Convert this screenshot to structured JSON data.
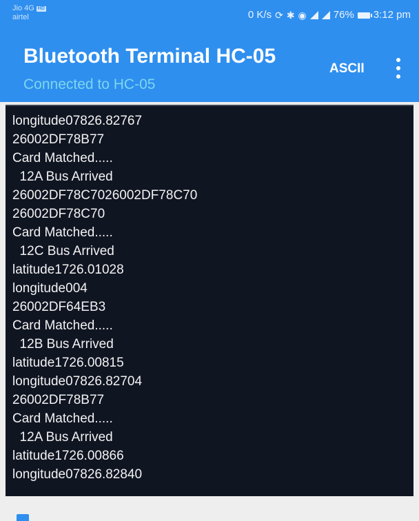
{
  "status_bar": {
    "carrier_top": "Jio 4G",
    "hd_badge": "HD",
    "carrier_bottom": "airtel",
    "net_speed": "0 K/s",
    "battery_percent": "76%",
    "time": "3:12 pm"
  },
  "app_bar": {
    "title": "Bluetooth Terminal HC-05",
    "subtitle": "Connected to HC-05",
    "ascii_label": "ASCII"
  },
  "terminal": {
    "lines": [
      "longitude07826.82767",
      "26002DF78B77",
      "Card Matched.....",
      "  12A Bus Arrived",
      "26002DF78C7026002DF78C70",
      "26002DF78C70",
      "Card Matched.....",
      "  12C Bus Arrived",
      "latitude1726.01028",
      "longitude004",
      "26002DF64EB3",
      "Card Matched.....",
      "  12B Bus Arrived",
      "latitude1726.00815",
      "longitude07826.82704",
      "26002DF78B77",
      "Card Matched.....",
      "  12A Bus Arrived",
      "latitude1726.00866",
      "longitude07826.82840"
    ]
  },
  "colors": {
    "app_bar": "#2f8fef",
    "subtitle": "#7dd6ee",
    "terminal_bg": "#101522"
  },
  "icons": [
    "signal-icon",
    "bluetooth-icon",
    "eye-icon",
    "battery-icon",
    "overflow-menu-icon"
  ]
}
